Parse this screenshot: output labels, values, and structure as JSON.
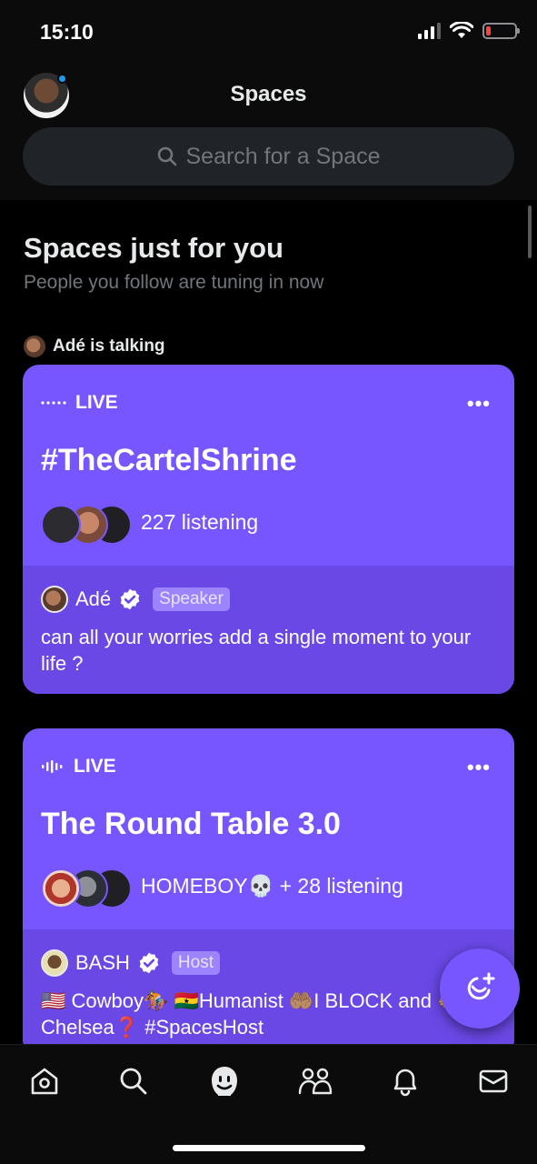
{
  "status_bar": {
    "time": "15:10"
  },
  "header": {
    "title": "Spaces",
    "search_placeholder": "Search for a Space"
  },
  "section": {
    "title": "Spaces just for you",
    "subtitle": "People you follow are tuning in now"
  },
  "activity": {
    "talking_label": "Adé is talking"
  },
  "cards": [
    {
      "live_label": "LIVE",
      "more_label": "•••",
      "title": "#TheCartelShrine",
      "listening": "227 listening",
      "speaker": {
        "name": "Adé",
        "role": "Speaker"
      },
      "description": "can all your worries add a single moment to your life ?"
    },
    {
      "live_label": "LIVE",
      "more_label": "•••",
      "title": "The Round Table 3.0",
      "listening": "HOMEBOY💀 + 28 listening",
      "speaker": {
        "name": "BASH",
        "role": "Host"
      },
      "description": "🇺🇸 Cowboy🏇 🇬🇭Humanist 🤲🏽I BLOCK and 🫲Chelsea❓ #SpacesHost"
    }
  ],
  "tabs": [
    "Home",
    "Search",
    "Spaces",
    "Communities",
    "Notifications",
    "Messages"
  ],
  "colors": {
    "accent": "#7856ff",
    "background": "#000000",
    "verified": "#1d9bf0"
  }
}
